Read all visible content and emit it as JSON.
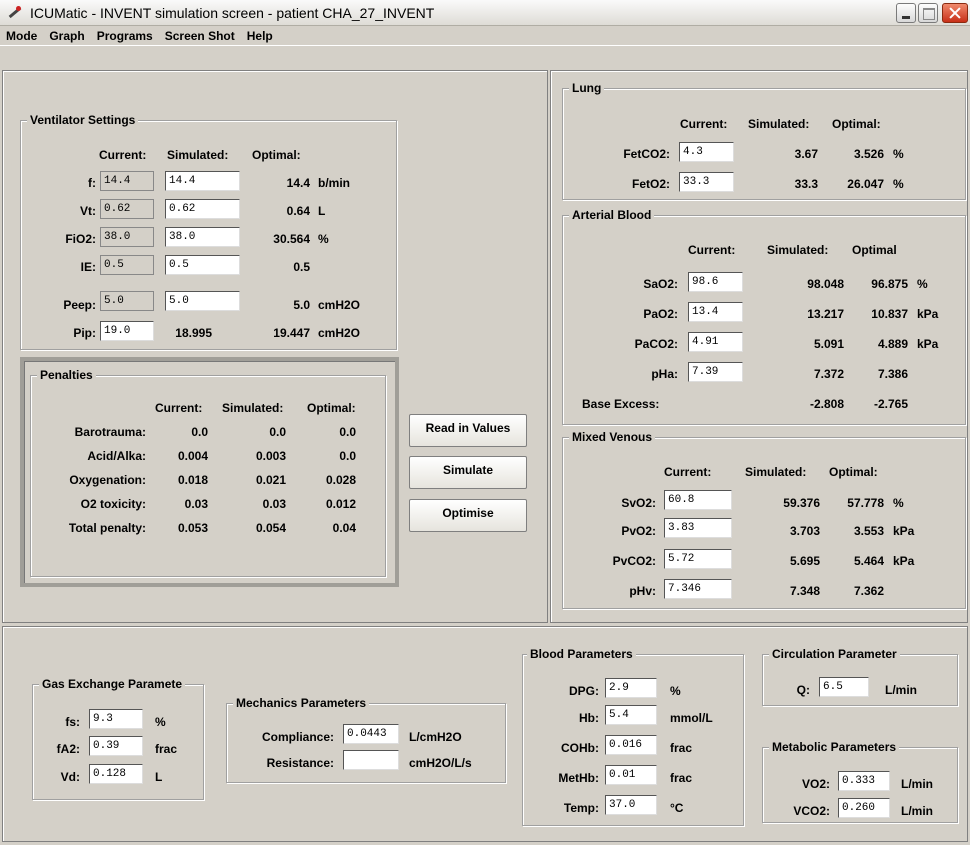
{
  "title": "ICUMatic - INVENT simulation screen - patient CHA_27_INVENT",
  "menu": [
    "Mode",
    "Graph",
    "Programs",
    "Screen Shot",
    "Help"
  ],
  "ventilator": {
    "title": "Ventilator Settings",
    "h_current": "Current:",
    "h_simulated": "Simulated:",
    "h_optimal": "Optimal:",
    "rows": [
      {
        "label": "f:",
        "current": "14.4",
        "simulated": "14.4",
        "optimal": "14.4",
        "unit": "b/min"
      },
      {
        "label": "Vt:",
        "current": "0.62",
        "simulated": "0.62",
        "optimal": "0.64",
        "unit": "L"
      },
      {
        "label": "FiO2:",
        "current": "38.0",
        "simulated": "38.0",
        "optimal": "30.564",
        "unit": "%"
      },
      {
        "label": "IE:",
        "current": "0.5",
        "simulated": "0.5",
        "optimal": "0.5",
        "unit": ""
      },
      {
        "label": "Peep:",
        "current": "5.0",
        "simulated": "5.0",
        "optimal": "5.0",
        "unit": "cmH2O"
      },
      {
        "label": "Pip:",
        "current": "19.0",
        "simulated": "18.995",
        "optimal": "19.447",
        "unit": "cmH2O"
      }
    ]
  },
  "penalties": {
    "title": "Penalties",
    "h_current": "Current:",
    "h_simulated": "Simulated:",
    "h_optimal": "Optimal:",
    "rows": [
      {
        "label": "Barotrauma:",
        "current": "0.0",
        "simulated": "0.0",
        "optimal": "0.0"
      },
      {
        "label": "Acid/Alka:",
        "current": "0.004",
        "simulated": "0.003",
        "optimal": "0.0"
      },
      {
        "label": "Oxygenation:",
        "current": "0.018",
        "simulated": "0.021",
        "optimal": "0.028"
      },
      {
        "label": "O2 toxicity:",
        "current": "0.03",
        "simulated": "0.03",
        "optimal": "0.012"
      },
      {
        "label": "Total penalty:",
        "current": "0.053",
        "simulated": "0.054",
        "optimal": "0.04"
      }
    ]
  },
  "buttons": {
    "read": "Read in Values",
    "simulate": "Simulate",
    "optimise": "Optimise"
  },
  "lung": {
    "title": "Lung",
    "h_current": "Current:",
    "h_simulated": "Simulated:",
    "h_optimal": "Optimal:",
    "rows": [
      {
        "label": "FetCO2:",
        "current": "4.3",
        "simulated": "3.67",
        "optimal": "3.526",
        "unit": "%"
      },
      {
        "label": "FetO2:",
        "current": "33.3",
        "simulated": "33.3",
        "optimal": "26.047",
        "unit": "%"
      }
    ]
  },
  "arterial": {
    "title": "Arterial Blood",
    "h_current": "Current:",
    "h_simulated": "Simulated:",
    "h_optimal": "Optimal",
    "rows": [
      {
        "label": "SaO2:",
        "current": "98.6",
        "simulated": "98.048",
        "optimal": "96.875",
        "unit": "%"
      },
      {
        "label": "PaO2:",
        "current": "13.4",
        "simulated": "13.217",
        "optimal": "10.837",
        "unit": "kPa"
      },
      {
        "label": "PaCO2:",
        "current": "4.91",
        "simulated": "5.091",
        "optimal": "4.889",
        "unit": "kPa"
      },
      {
        "label": "pHa:",
        "current": "7.39",
        "simulated": "7.372",
        "optimal": "7.386",
        "unit": ""
      }
    ],
    "base_label": "Base Excess:",
    "base_simulated": "-2.808",
    "base_optimal": "-2.765"
  },
  "venous": {
    "title": "Mixed Venous",
    "h_current": "Current:",
    "h_simulated": "Simulated:",
    "h_optimal": "Optimal:",
    "rows": [
      {
        "label": "SvO2:",
        "current": "60.8",
        "simulated": "59.376",
        "optimal": "57.778",
        "unit": "%"
      },
      {
        "label": "PvO2:",
        "current": "3.83",
        "simulated": "3.703",
        "optimal": "3.553",
        "unit": "kPa"
      },
      {
        "label": "PvCO2:",
        "current": "5.72",
        "simulated": "5.695",
        "optimal": "5.464",
        "unit": "kPa"
      },
      {
        "label": "pHv:",
        "current": "7.346",
        "simulated": "7.348",
        "optimal": "7.362",
        "unit": ""
      }
    ]
  },
  "gas": {
    "title": "Gas Exchange Paramete",
    "rows": [
      {
        "label": "fs:",
        "value": "9.3",
        "unit": "%"
      },
      {
        "label": "fA2:",
        "value": "0.39",
        "unit": "frac"
      },
      {
        "label": "Vd:",
        "value": "0.128",
        "unit": "L"
      }
    ]
  },
  "mechanics": {
    "title": "Mechanics Parameters",
    "rows": [
      {
        "label": "Compliance:",
        "value": "0.0443",
        "unit": "L/cmH2O"
      },
      {
        "label": "Resistance:",
        "value": "",
        "unit": "cmH2O/L/s"
      }
    ]
  },
  "blood": {
    "title": "Blood Parameters",
    "rows": [
      {
        "label": "DPG:",
        "value": "2.9",
        "unit": "%"
      },
      {
        "label": "Hb:",
        "value": "5.4",
        "unit": "mmol/L"
      },
      {
        "label": "COHb:",
        "value": "0.016",
        "unit": "frac"
      },
      {
        "label": "MetHb:",
        "value": "0.01",
        "unit": "frac"
      },
      {
        "label": "Temp:",
        "value": "37.0",
        "unit": "°C"
      }
    ]
  },
  "circulation": {
    "title": "Circulation Parameter",
    "label": "Q:",
    "value": "6.5",
    "unit": "L/min"
  },
  "metabolic": {
    "title": "Metabolic Parameters",
    "rows": [
      {
        "label": "VO2:",
        "value": "0.333",
        "unit": "L/min"
      },
      {
        "label": "VCO2:",
        "value": "0.260",
        "unit": "L/min"
      }
    ]
  }
}
